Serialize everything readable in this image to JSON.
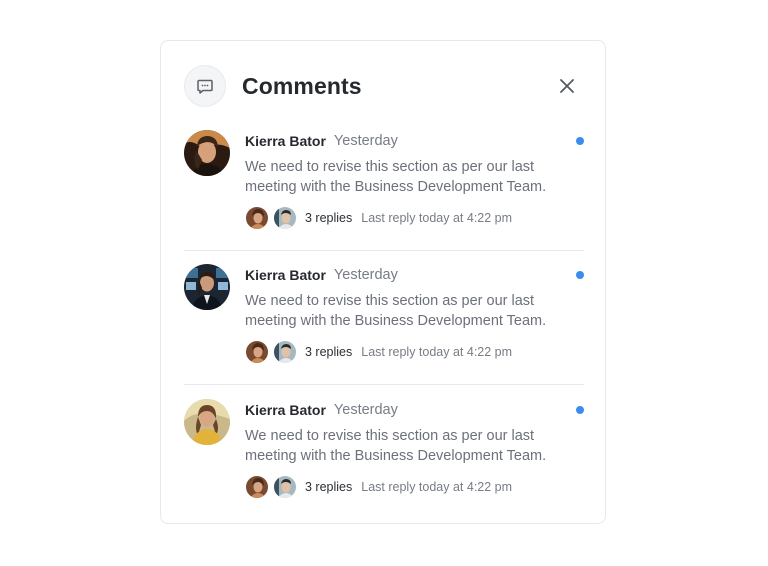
{
  "panel": {
    "title": "Comments",
    "header_icon": "chat-bubble-icon",
    "close_icon": "close-icon"
  },
  "comments": [
    {
      "author": "Kierra Bator",
      "time": "Yesterday",
      "text": "We need to revise this section as per our last meeting with the Business Development Team.",
      "replies": "3 replies",
      "last_reply": "Last reply today at 4:22 pm",
      "unread": true,
      "avatar": "avatar-woman-dark-hair"
    },
    {
      "author": "Kierra Bator",
      "time": "Yesterday",
      "text": "We need to revise this section as per our last meeting with the Business Development Team.",
      "replies": "3 replies",
      "last_reply": "Last reply today at 4:22 pm",
      "unread": true,
      "avatar": "avatar-woman-office"
    },
    {
      "author": "Kierra Bator",
      "time": "Yesterday",
      "text": "We need to revise this section as per our last meeting with the Business Development Team.",
      "replies": "3 replies",
      "last_reply": "Last reply today at 4:22 pm",
      "unread": true,
      "avatar": "avatar-woman-yellow"
    }
  ],
  "colors": {
    "unread_dot": "#3b8cef",
    "divider": "#e8eaee",
    "muted_text": "#6b707a"
  }
}
